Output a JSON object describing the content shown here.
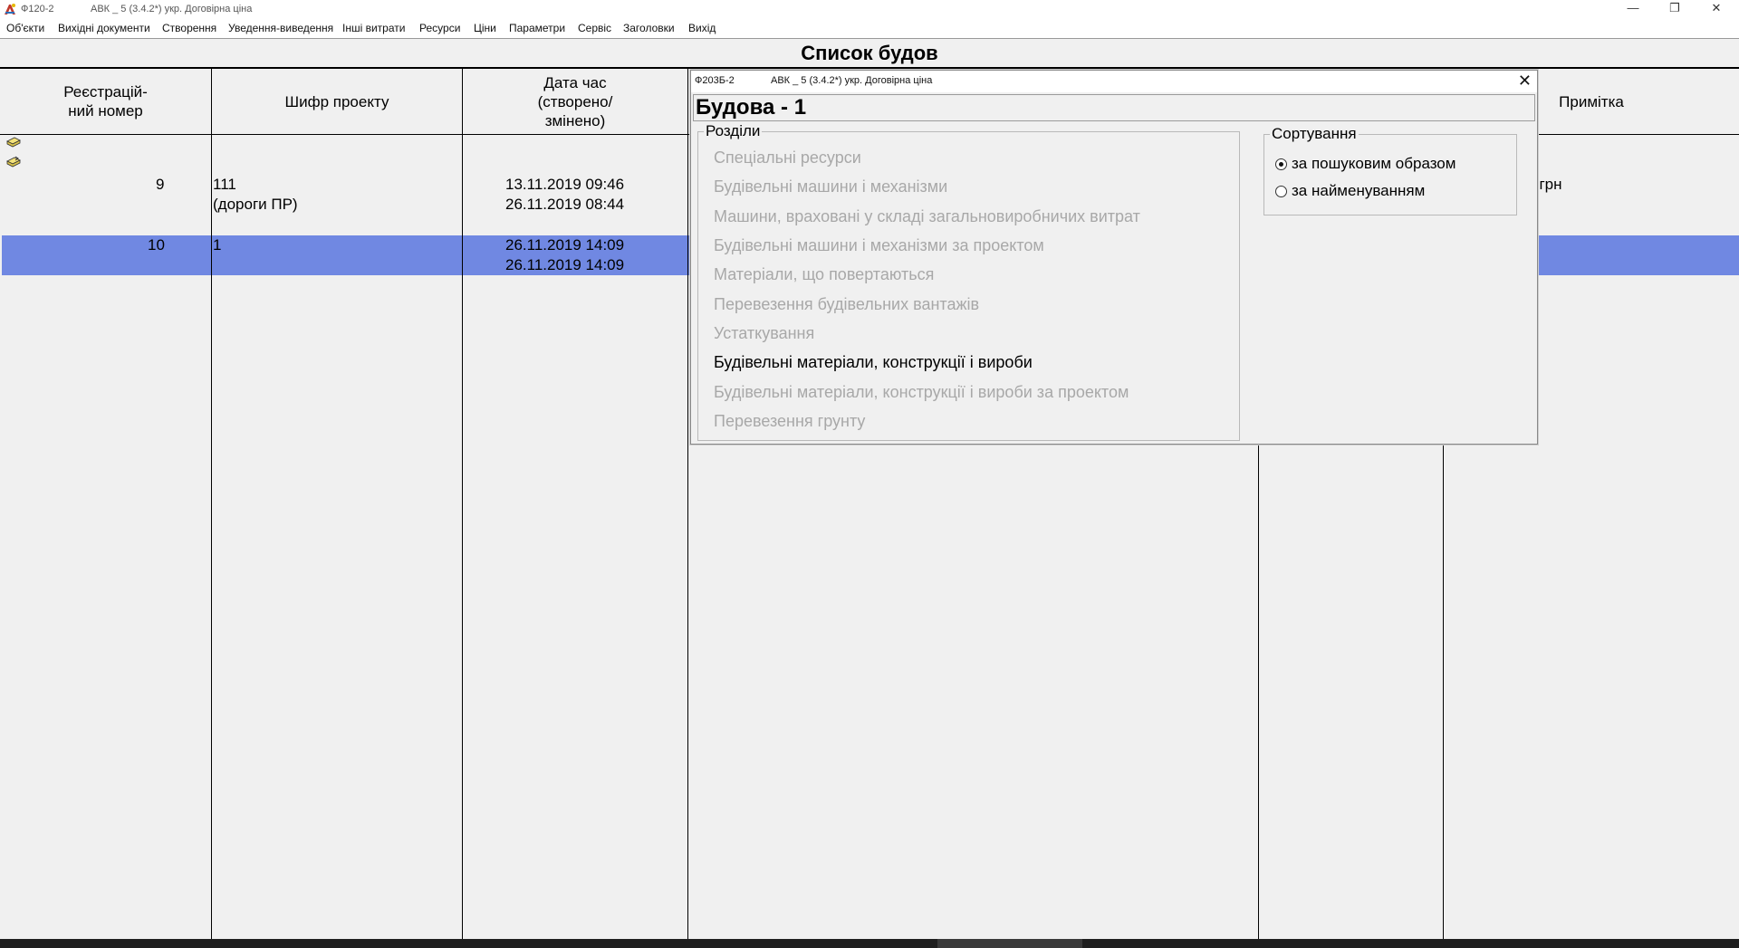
{
  "window": {
    "form_code": "Ф120-2",
    "app_title": "АВК _ 5 (3.4.2*) укр. Договірна ціна",
    "minimize_glyph": "—",
    "restore_glyph": "❐",
    "close_glyph": "✕"
  },
  "menu": {
    "items": [
      "Об'єкти",
      "Вихідні документи",
      "Створення",
      "Уведення-виведення",
      "Інші витрати",
      "Ресурси",
      "Ціни",
      "Параметри",
      "Сервіс",
      "Заголовки",
      "Вихід"
    ]
  },
  "list": {
    "title": "Список будов",
    "columns": {
      "reg_number": "Реєстрацій-\nний номер",
      "project_code": "Шифр проекту",
      "datetime": "Дата час\n(створено/\nзмінено)",
      "note": "Примітка"
    },
    "rows": [
      {
        "reg": "9",
        "code_line1": "111",
        "code_line2": "(дороги ПР)",
        "created": "13.11.2019 09:46",
        "modified": "26.11.2019 08:44",
        "note": "4грн"
      },
      {
        "reg": "10",
        "code_line1": "1",
        "code_line2": "",
        "created": "26.11.2019 14:09",
        "modified": "26.11.2019 14:09",
        "note": ""
      }
    ],
    "selected_row_color": "#7088e2"
  },
  "toolbar_icons": [
    "stack-icon",
    "stack-arrow-icon"
  ],
  "dialog": {
    "form_code": "Ф203Б-2",
    "app_title": "АВК _ 5 (3.4.2*) укр. Договірна ціна",
    "close_glyph": "✕",
    "heading": "Будова - 1",
    "sections_label": "Розділи",
    "sections": [
      {
        "label": "Спеціальні ресурси",
        "enabled": false
      },
      {
        "label": "Будівельні машини і механізми",
        "enabled": false
      },
      {
        "label": "Машини, враховані у складі загальновиробничих витрат",
        "enabled": false
      },
      {
        "label": "Будівельні машини і механізми за проектом",
        "enabled": false
      },
      {
        "label": "Матеріали, що повертаються",
        "enabled": false
      },
      {
        "label": "Перевезення будівельних вантажів",
        "enabled": false
      },
      {
        "label": "Устаткування",
        "enabled": false
      },
      {
        "label": "Будівельні матеріали, конструкції і вироби",
        "enabled": true
      },
      {
        "label": "Будівельні матеріали, конструкції і вироби за проектом",
        "enabled": false
      },
      {
        "label": "Перевезення грунту",
        "enabled": false
      }
    ],
    "sorting_label": "Сортування",
    "sort_options": [
      {
        "label": "за пошуковим образом",
        "checked": true
      },
      {
        "label": "за найменуванням",
        "checked": false
      }
    ]
  }
}
